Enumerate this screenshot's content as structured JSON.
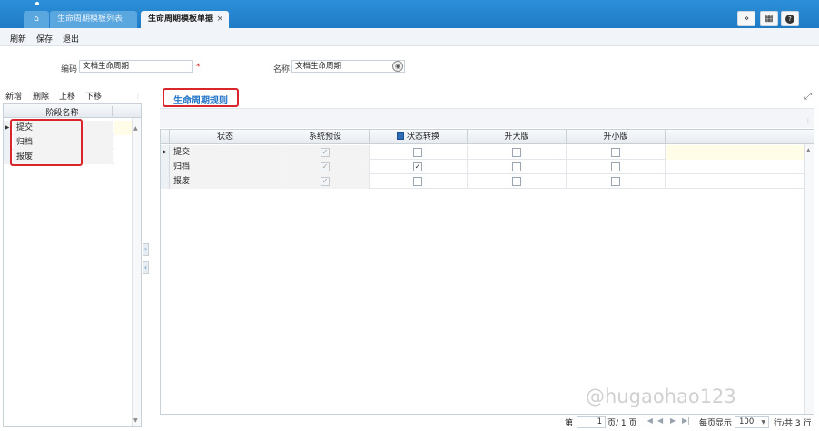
{
  "tabs": {
    "home_icon": "home-icon",
    "list_label": "生命周期模板列表",
    "active_label": "生命周期模板单据",
    "close_glyph": "×"
  },
  "header_buttons": {
    "expand": "»",
    "grid": "▦",
    "help": "?"
  },
  "menu": {
    "refresh": "刷新",
    "save": "保存",
    "exit": "退出"
  },
  "form": {
    "code_label": "编码",
    "code_value": "文档生命周期",
    "required_mark": "*",
    "name_label": "名称",
    "name_value": "文档生命周期"
  },
  "left": {
    "toolbar": {
      "add": "新增",
      "delete": "删除",
      "up": "上移",
      "down": "下移"
    },
    "column_header": "阶段名称",
    "rows": [
      "提交",
      "归档",
      "报废"
    ]
  },
  "right": {
    "title": "生命周期规则",
    "columns": [
      "状态",
      "系统预设",
      "状态转换",
      "升大版",
      "升小版"
    ],
    "rows": [
      {
        "state": "提交",
        "system_preset": true,
        "state_transition": false,
        "major_version": false,
        "minor_version": false
      },
      {
        "state": "归档",
        "system_preset": true,
        "state_transition": true,
        "major_version": false,
        "minor_version": false
      },
      {
        "state": "报废",
        "system_preset": true,
        "state_transition": false,
        "major_version": false,
        "minor_version": false
      }
    ]
  },
  "pager": {
    "page_prefix": "第",
    "page_value": "1",
    "page_suffix": "页/ 1 页",
    "per_page_label": "每页显示",
    "per_page_value": "100",
    "total_text": "行/共 3 行"
  },
  "watermark": "@hugaohao123"
}
